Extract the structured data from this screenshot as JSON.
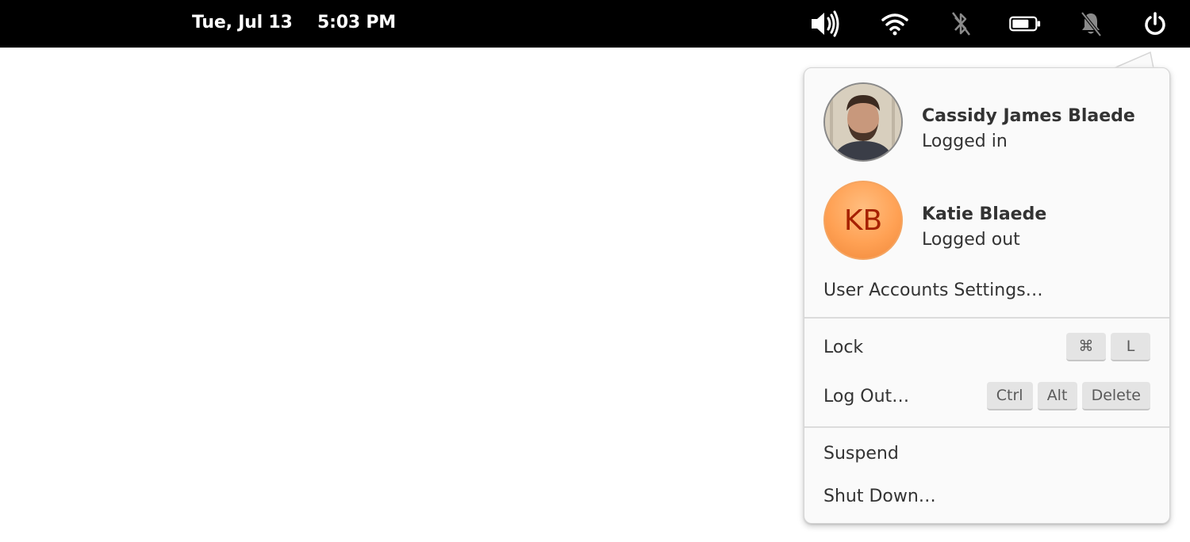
{
  "panel": {
    "date": "Tue, Jul 13",
    "time": "5:03 PM",
    "indicators": [
      {
        "icon": "audio-volume-high-icon"
      },
      {
        "icon": "wifi-icon"
      },
      {
        "icon": "bluetooth-disabled-icon"
      },
      {
        "icon": "battery-icon"
      },
      {
        "icon": "notifications-disabled-icon"
      },
      {
        "icon": "power-icon"
      }
    ]
  },
  "session_menu": {
    "users": [
      {
        "name": "Cassidy James Blaede",
        "status": "Logged in",
        "avatar": "photo"
      },
      {
        "name": "Katie Blaede",
        "status": "Logged out",
        "initials": "KB"
      }
    ],
    "accounts_settings": "User Accounts Settings…",
    "lock": {
      "label": "Lock",
      "keys": [
        "⌘",
        "L"
      ]
    },
    "logout": {
      "label": "Log Out…",
      "keys": [
        "Ctrl",
        "Alt",
        "Delete"
      ]
    },
    "suspend": "Suspend",
    "shutdown": "Shut Down…"
  },
  "colors": {
    "panel_bg": "#000000",
    "popover_bg": "#fafafa",
    "initials_avatar": "#ffa154",
    "initials_text": "#a62100"
  }
}
